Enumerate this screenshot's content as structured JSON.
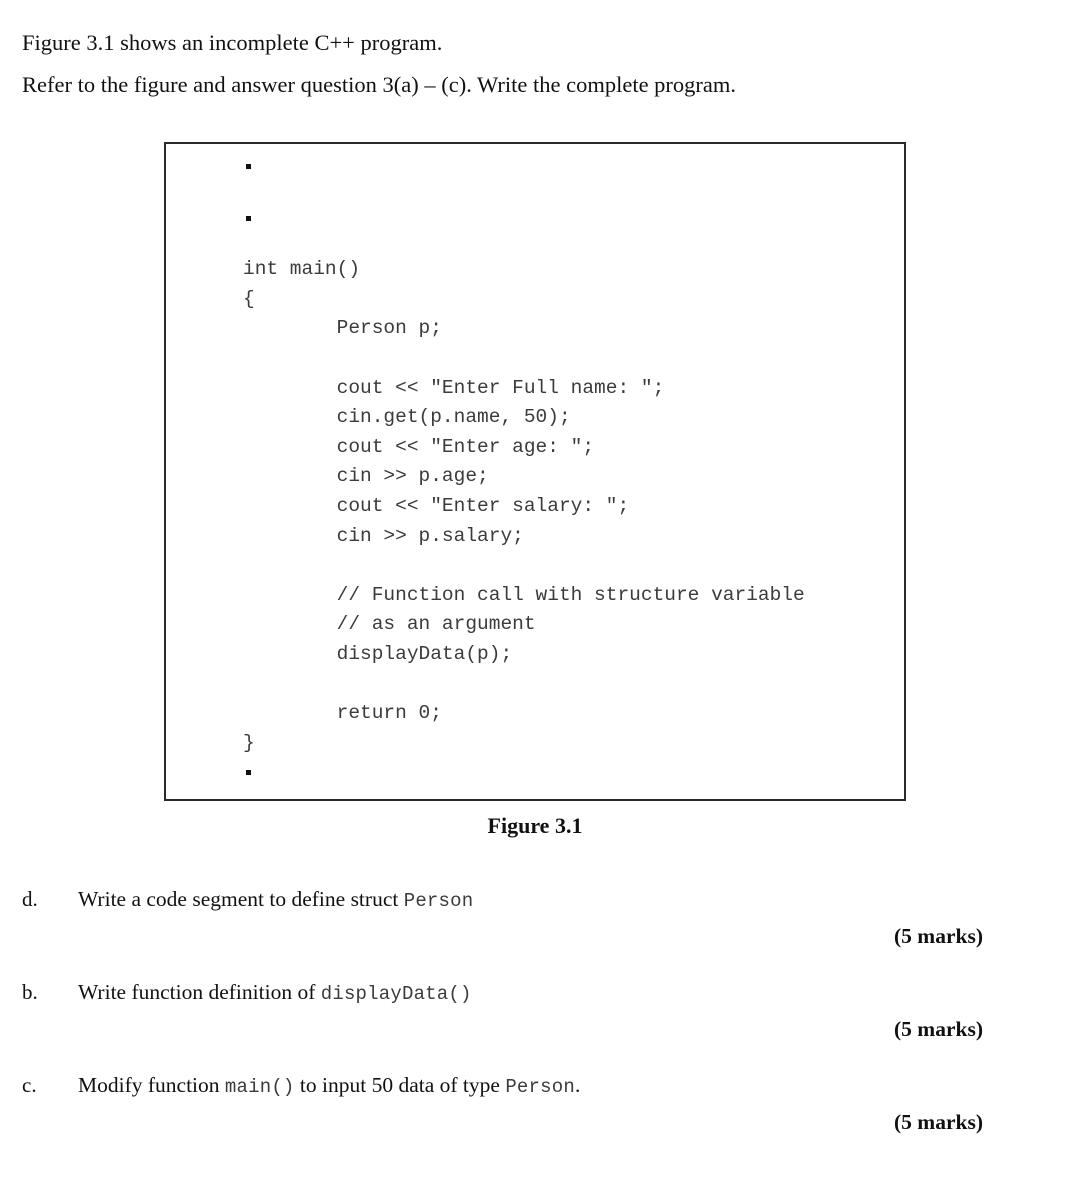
{
  "document": {
    "intro_lines": [
      "Figure 3.1 shows an incomplete C++ program.",
      "Refer to the figure and answer question 3(a) – (c). Write the complete program."
    ],
    "figure": {
      "caption": "Figure 3.1",
      "code_lines": [
        {
          "type": "dot"
        },
        {
          "type": "dot"
        },
        {
          "type": "code",
          "text": "int main()"
        },
        {
          "type": "code",
          "text": "{"
        },
        {
          "type": "code",
          "text": "        Person p;"
        },
        {
          "type": "blank",
          "text": " "
        },
        {
          "type": "code",
          "text": "        cout << \"Enter Full name: \";"
        },
        {
          "type": "code",
          "text": "        cin.get(p.name, 50);"
        },
        {
          "type": "code",
          "text": "        cout << \"Enter age: \";"
        },
        {
          "type": "code",
          "text": "        cin >> p.age;"
        },
        {
          "type": "code",
          "text": "        cout << \"Enter salary: \";"
        },
        {
          "type": "code",
          "text": "        cin >> p.salary;"
        },
        {
          "type": "blank",
          "text": " "
        },
        {
          "type": "code",
          "text": "        // Function call with structure variable"
        },
        {
          "type": "code",
          "text": "        // as an argument"
        },
        {
          "type": "code",
          "text": "        displayData(p);"
        },
        {
          "type": "blank",
          "text": " "
        },
        {
          "type": "code",
          "text": "        return 0;"
        },
        {
          "type": "code",
          "text": "}"
        },
        {
          "type": "dot"
        },
        {
          "type": "dot"
        },
        {
          "type": "dot"
        }
      ]
    },
    "questions": [
      {
        "label": "d.",
        "parts": [
          {
            "kind": "text",
            "text": "Write a code segment to define "
          },
          {
            "kind": "text",
            "text": "struct "
          },
          {
            "kind": "code",
            "text": "Person"
          }
        ],
        "marks": "(5 marks)"
      },
      {
        "label": "b.",
        "parts": [
          {
            "kind": "text",
            "text": "Write function definition of "
          },
          {
            "kind": "code",
            "text": "displayData()"
          }
        ],
        "marks": "(5 marks)"
      },
      {
        "label": "c.",
        "parts": [
          {
            "kind": "text",
            "text": "Modify  function "
          },
          {
            "kind": "code",
            "text": "main()"
          },
          {
            "kind": "text",
            "text": " to input 50 data  of  type "
          },
          {
            "kind": "code",
            "text": "Person"
          },
          {
            "kind": "text",
            "text": "."
          }
        ],
        "marks": "(5 marks)"
      }
    ]
  }
}
